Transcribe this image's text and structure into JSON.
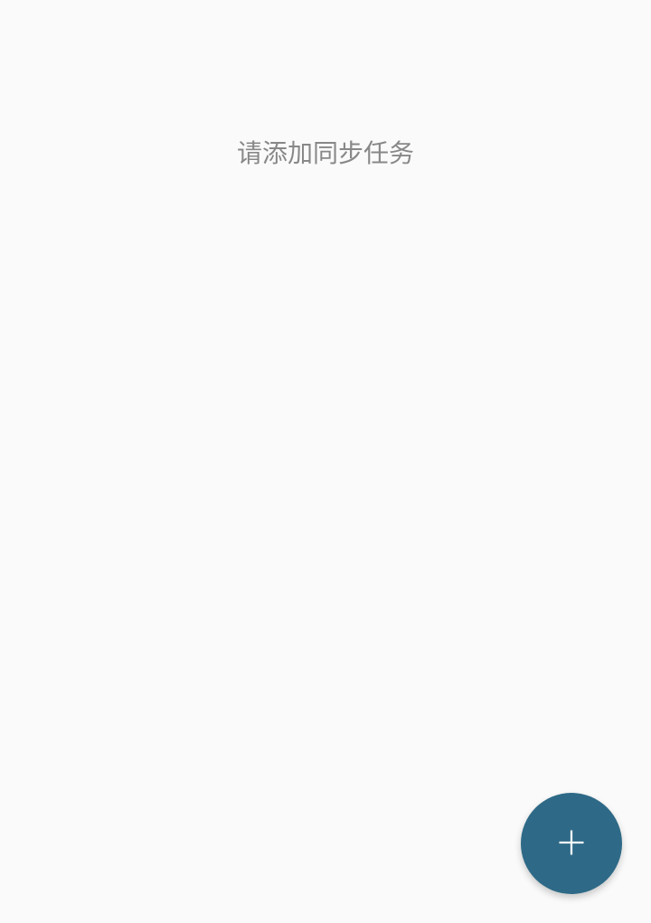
{
  "emptyState": {
    "message": "请添加同步任务"
  },
  "fab": {
    "iconName": "plus-icon"
  },
  "colors": {
    "accent": "#2e6a87",
    "textMuted": "#888888",
    "background": "#fafafa"
  }
}
